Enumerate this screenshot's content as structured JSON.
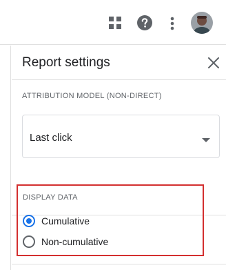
{
  "topbar": {
    "apps_icon": "apps-grid-icon",
    "help_icon": "help-icon",
    "more_icon": "more-vert-icon",
    "avatar": "user-avatar"
  },
  "panel": {
    "title": "Report settings",
    "close_icon": "close-icon",
    "attribution": {
      "label": "ATTRIBUTION MODEL (NON-DIRECT)",
      "selected": "Last click",
      "arrow_icon": "dropdown-arrow-icon"
    },
    "display_data": {
      "label": "DISPLAY DATA",
      "options": [
        {
          "label": "Cumulative",
          "checked": true
        },
        {
          "label": "Non-cumulative",
          "checked": false
        }
      ]
    }
  },
  "colors": {
    "accent": "#1a73e8",
    "highlight_border": "#d32f2f",
    "icon": "#5f6368",
    "text": "#202124",
    "divider": "#e0e0e0"
  }
}
